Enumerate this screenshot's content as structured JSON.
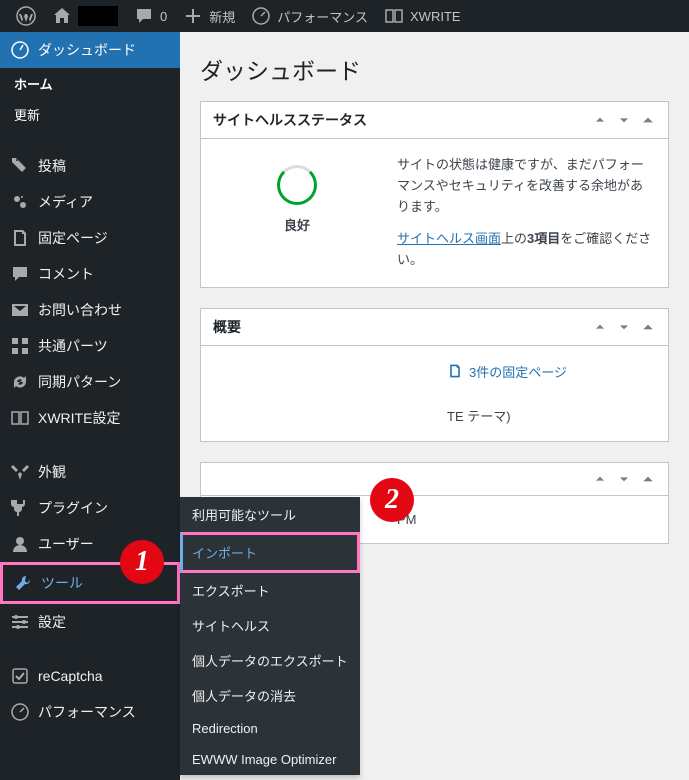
{
  "adminbar": {
    "comments": "0",
    "new": "新規",
    "perf": "パフォーマンス",
    "xwrite": "XWRITE"
  },
  "sidebar": {
    "dashboard": "ダッシュボード",
    "home": "ホーム",
    "updates": "更新",
    "posts": "投稿",
    "media": "メディア",
    "pages": "固定ページ",
    "comments": "コメント",
    "contact": "お問い合わせ",
    "common_parts": "共通パーツ",
    "sync_patterns": "同期パターン",
    "xwrite_settings": "XWRITE設定",
    "appearance": "外観",
    "plugins": "プラグイン",
    "users": "ユーザー",
    "tools": "ツール",
    "settings": "設定",
    "recaptcha": "reCaptcha",
    "performance": "パフォーマンス"
  },
  "flyout": {
    "available": "利用可能なツール",
    "import": "インポート",
    "export": "エクスポート",
    "site_health": "サイトヘルス",
    "export_data": "個人データのエクスポート",
    "erase_data": "個人データの消去",
    "redirection": "Redirection",
    "ewww": "EWWW Image Optimizer"
  },
  "badges": {
    "one": "1",
    "two": "2"
  },
  "main": {
    "title": "ダッシュボード",
    "health": {
      "heading": "サイトヘルスステータス",
      "status": "良好",
      "desc": "サイトの状態は健康ですが、まだパフォーマンスやセキュリティを改善する余地があります。",
      "link": "サイトヘルス画面",
      "after1": "上の",
      "bold": "3項目",
      "after2": "をご確認ください。"
    },
    "overview": {
      "heading": "概要",
      "pages": "3件の固定ページ",
      "theme_suffix": "TE テーマ)",
      "time_suffix": "PM"
    }
  }
}
